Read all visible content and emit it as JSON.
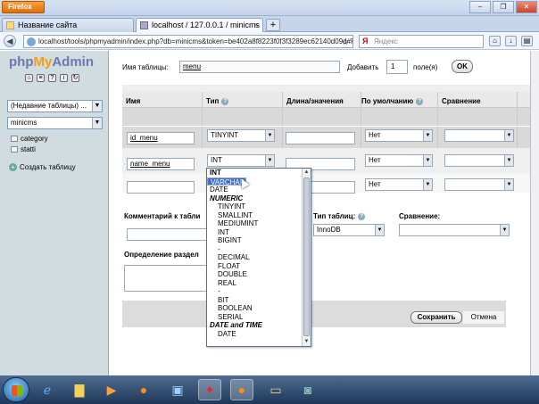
{
  "browser": {
    "menu_button": "Firefox",
    "window_controls": [
      "–",
      "❐",
      "✕"
    ],
    "tabs": [
      {
        "label": "Название сайта",
        "active": false
      },
      {
        "label": "localhost / 127.0.0.1 / minicms | php...",
        "active": true
      }
    ],
    "new_tab": "+",
    "url": "localhost/tools/phpmyadmin/index.php?db=minicms&token=be402a8f8223f0f3f3289ec62140d09d#PI",
    "search_placeholder": "Яндекс"
  },
  "sidebar": {
    "logo": {
      "php": "php",
      "my": "My",
      "admin": "Admin"
    },
    "db_select": "(Недавние таблицы) ...",
    "db_name_select": "minicms",
    "tables": [
      "category",
      "statti"
    ],
    "create_table": "Создать таблицу"
  },
  "form": {
    "table_name_label": "Имя таблицы:",
    "table_name_value": "menu",
    "add_label": "Добавить",
    "add_count": "1",
    "fields_label": "поле(я)",
    "ok_label": "OK",
    "columns": [
      "Имя",
      "Тип",
      "Длина/значения",
      "По умолчанию",
      "Сравнение",
      "А"
    ],
    "rows": [
      {
        "name": "id_menu",
        "type": "TINYINT",
        "length": "",
        "default": "Нет",
        "collation": ""
      },
      {
        "name": "name_menu",
        "type": "INT",
        "length": "",
        "default": "Нет",
        "collation": ""
      },
      {
        "name": "",
        "type": "",
        "length": "",
        "default": "Нет",
        "collation": ""
      }
    ],
    "comment_label": "Комментарий к табли",
    "table_type_label": "Тип таблиц:",
    "table_type_value": "InnoDB",
    "collation_label": "Сравнение:",
    "partition_label": "Определение раздел",
    "save_label": "Сохранить",
    "cancel_label": "Отмена"
  },
  "type_dropdown": {
    "selected": "VARCHAR",
    "options": [
      {
        "label": "INT",
        "kind": "bold"
      },
      {
        "label": "VARCHAR",
        "kind": "selected"
      },
      {
        "label": "TEXT",
        "kind": "plain"
      },
      {
        "label": "DATE",
        "kind": "plain"
      },
      {
        "label": "NUMERIC",
        "kind": "group"
      },
      {
        "label": "TINYINT",
        "kind": "ind"
      },
      {
        "label": "SMALLINT",
        "kind": "ind"
      },
      {
        "label": "MEDIUMINT",
        "kind": "ind"
      },
      {
        "label": "INT",
        "kind": "ind"
      },
      {
        "label": "BIGINT",
        "kind": "ind"
      },
      {
        "label": "-",
        "kind": "ind"
      },
      {
        "label": "DECIMAL",
        "kind": "ind"
      },
      {
        "label": "FLOAT",
        "kind": "ind"
      },
      {
        "label": "DOUBLE",
        "kind": "ind"
      },
      {
        "label": "REAL",
        "kind": "ind"
      },
      {
        "label": "-",
        "kind": "ind"
      },
      {
        "label": "BIT",
        "kind": "ind"
      },
      {
        "label": "BOOLEAN",
        "kind": "ind"
      },
      {
        "label": "SERIAL",
        "kind": "ind"
      },
      {
        "label": "DATE and TIME",
        "kind": "group"
      },
      {
        "label": "DATE",
        "kind": "ind"
      }
    ]
  },
  "taskbar": {
    "icons": [
      "ie-icon",
      "folder-icon",
      "media-player-icon",
      "firefox-icon",
      "image-viewer-icon",
      "flash-icon",
      "firefox-icon",
      "notes-icon",
      "camera-icon"
    ]
  }
}
